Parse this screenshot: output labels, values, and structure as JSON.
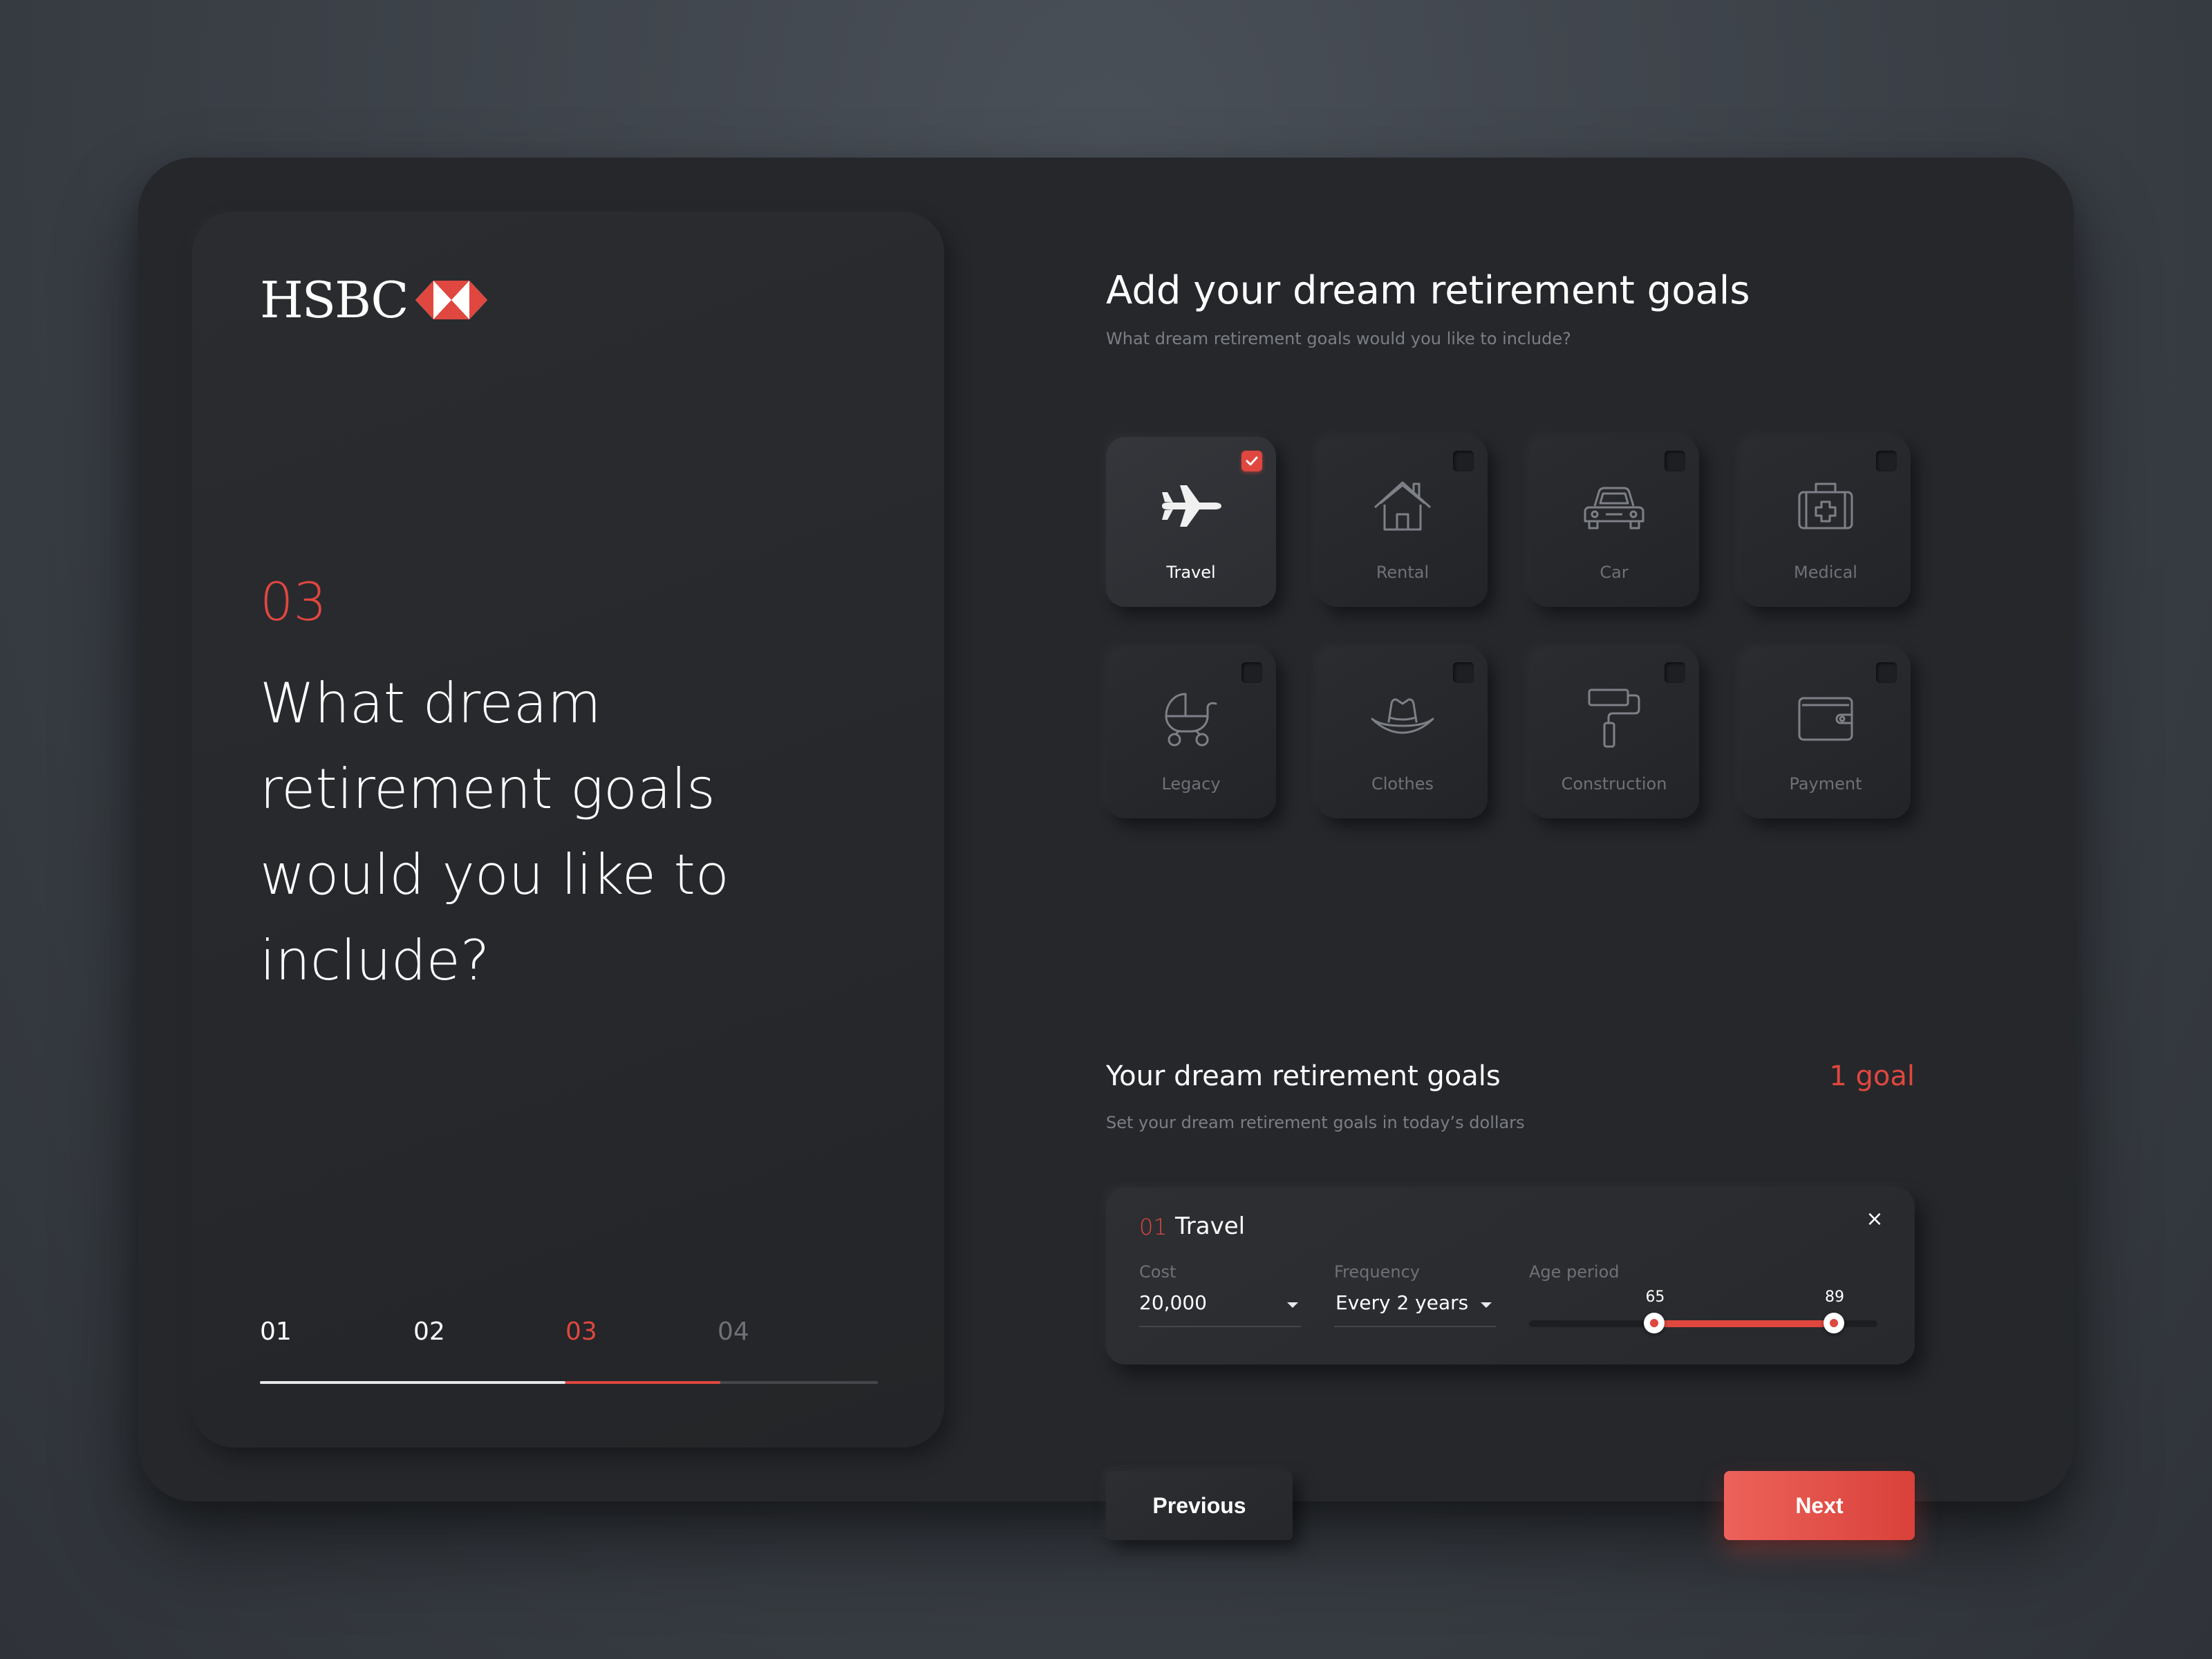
{
  "brand": {
    "logo_text": "HSBC",
    "accent_color": "#e0473f"
  },
  "left": {
    "step_number": "03",
    "question": "What dream retirement goals would you like to include?",
    "steps": [
      {
        "label": "01",
        "state": "done"
      },
      {
        "label": "02",
        "state": "done"
      },
      {
        "label": "03",
        "state": "current"
      },
      {
        "label": "04",
        "state": "todo"
      }
    ]
  },
  "main": {
    "title": "Add your dream retirement goals",
    "subtitle": "What dream retirement goals would you like to include?",
    "tiles": [
      {
        "label": "Travel",
        "icon": "airplane-icon",
        "selected": true
      },
      {
        "label": "Rental",
        "icon": "house-icon",
        "selected": false
      },
      {
        "label": "Car",
        "icon": "car-icon",
        "selected": false
      },
      {
        "label": "Medical",
        "icon": "medical-kit-icon",
        "selected": false
      },
      {
        "label": "Legacy",
        "icon": "stroller-icon",
        "selected": false
      },
      {
        "label": "Clothes",
        "icon": "hat-icon",
        "selected": false
      },
      {
        "label": "Construction",
        "icon": "paint-roller-icon",
        "selected": false
      },
      {
        "label": "Payment",
        "icon": "wallet-icon",
        "selected": false
      }
    ]
  },
  "goals": {
    "title": "Your dream retirement goals",
    "count": "1 goal",
    "subtitle": "Set your dream retirement goals in today’s dollars",
    "items": [
      {
        "index": "01",
        "name": "Travel",
        "cost_label": "Cost",
        "cost_value": "20,000",
        "frequency_label": "Frequency",
        "frequency_value": "Every 2 years",
        "age_label": "Age period",
        "age_start": "65",
        "age_end": "89",
        "age_start_fraction": 0.36,
        "age_end_fraction": 0.875,
        "close": "×"
      }
    ]
  },
  "buttons": {
    "previous": "Previous",
    "next": "Next"
  }
}
